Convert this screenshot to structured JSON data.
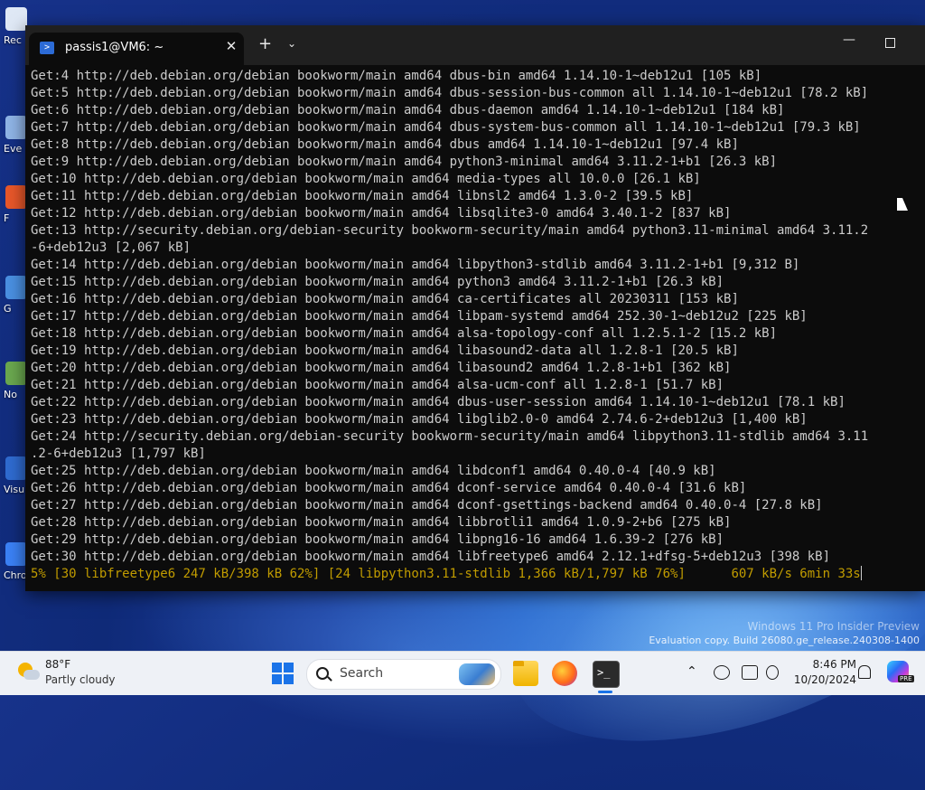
{
  "desktop": {
    "icons": [
      {
        "label": "Rec",
        "color": "#dfe8f5"
      },
      {
        "label": "Eve",
        "color": "#8fb4e6"
      },
      {
        "label": "F",
        "color": "#e8572a"
      },
      {
        "label": "G",
        "color": "#4a90e2"
      },
      {
        "label": "No",
        "color": "#6aa84f"
      },
      {
        "label": "Visu",
        "color": "#2f6bd0"
      },
      {
        "label": "Chromium",
        "color": "#3b82f6"
      }
    ],
    "watermark": {
      "line1": "Windows 11 Pro Insider Preview",
      "line2": "Evaluation copy. Build 26080.ge_release.240308-1400"
    }
  },
  "terminal": {
    "tab_title": "passis1@VM6: ~",
    "tab_icon": "powershell-icon",
    "lines": [
      "Get:4 http://deb.debian.org/debian bookworm/main amd64 dbus-bin amd64 1.14.10-1~deb12u1 [105 kB]",
      "Get:5 http://deb.debian.org/debian bookworm/main amd64 dbus-session-bus-common all 1.14.10-1~deb12u1 [78.2 kB]",
      "Get:6 http://deb.debian.org/debian bookworm/main amd64 dbus-daemon amd64 1.14.10-1~deb12u1 [184 kB]",
      "Get:7 http://deb.debian.org/debian bookworm/main amd64 dbus-system-bus-common all 1.14.10-1~deb12u1 [79.3 kB]",
      "Get:8 http://deb.debian.org/debian bookworm/main amd64 dbus amd64 1.14.10-1~deb12u1 [97.4 kB]",
      "Get:9 http://deb.debian.org/debian bookworm/main amd64 python3-minimal amd64 3.11.2-1+b1 [26.3 kB]",
      "Get:10 http://deb.debian.org/debian bookworm/main amd64 media-types all 10.0.0 [26.1 kB]",
      "Get:11 http://deb.debian.org/debian bookworm/main amd64 libnsl2 amd64 1.3.0-2 [39.5 kB]",
      "Get:12 http://deb.debian.org/debian bookworm/main amd64 libsqlite3-0 amd64 3.40.1-2 [837 kB]",
      "Get:13 http://security.debian.org/debian-security bookworm-security/main amd64 python3.11-minimal amd64 3.11.2",
      "-6+deb12u3 [2,067 kB]",
      "Get:14 http://deb.debian.org/debian bookworm/main amd64 libpython3-stdlib amd64 3.11.2-1+b1 [9,312 B]",
      "Get:15 http://deb.debian.org/debian bookworm/main amd64 python3 amd64 3.11.2-1+b1 [26.3 kB]",
      "Get:16 http://deb.debian.org/debian bookworm/main amd64 ca-certificates all 20230311 [153 kB]",
      "Get:17 http://deb.debian.org/debian bookworm/main amd64 libpam-systemd amd64 252.30-1~deb12u2 [225 kB]",
      "Get:18 http://deb.debian.org/debian bookworm/main amd64 alsa-topology-conf all 1.2.5.1-2 [15.2 kB]",
      "Get:19 http://deb.debian.org/debian bookworm/main amd64 libasound2-data all 1.2.8-1 [20.5 kB]",
      "Get:20 http://deb.debian.org/debian bookworm/main amd64 libasound2 amd64 1.2.8-1+b1 [362 kB]",
      "Get:21 http://deb.debian.org/debian bookworm/main amd64 alsa-ucm-conf all 1.2.8-1 [51.7 kB]",
      "Get:22 http://deb.debian.org/debian bookworm/main amd64 dbus-user-session amd64 1.14.10-1~deb12u1 [78.1 kB]",
      "Get:23 http://deb.debian.org/debian bookworm/main amd64 libglib2.0-0 amd64 2.74.6-2+deb12u3 [1,400 kB]",
      "Get:24 http://security.debian.org/debian-security bookworm-security/main amd64 libpython3.11-stdlib amd64 3.11",
      ".2-6+deb12u3 [1,797 kB]",
      "Get:25 http://deb.debian.org/debian bookworm/main amd64 libdconf1 amd64 0.40.0-4 [40.9 kB]",
      "Get:26 http://deb.debian.org/debian bookworm/main amd64 dconf-service amd64 0.40.0-4 [31.6 kB]",
      "Get:27 http://deb.debian.org/debian bookworm/main amd64 dconf-gsettings-backend amd64 0.40.0-4 [27.8 kB]",
      "Get:28 http://deb.debian.org/debian bookworm/main amd64 libbrotli1 amd64 1.0.9-2+b6 [275 kB]",
      "Get:29 http://deb.debian.org/debian bookworm/main amd64 libpng16-16 amd64 1.6.39-2 [276 kB]",
      "Get:30 http://deb.debian.org/debian bookworm/main amd64 libfreetype6 amd64 2.12.1+dfsg-5+deb12u3 [398 kB]"
    ],
    "progress_line": "5% [30 libfreetype6 247 kB/398 kB 62%] [24 libpython3.11-stdlib 1,366 kB/1,797 kB 76%]      607 kB/s 6min 33s",
    "colors": {
      "background": "#0c0c0c",
      "text": "#cccccc",
      "progress": "#c19c00"
    }
  },
  "taskbar": {
    "weather": {
      "temp": "88°F",
      "desc": "Partly cloudy"
    },
    "search_placeholder": "Search",
    "apps": [
      "file-explorer-icon",
      "firefox-icon",
      "terminal-icon"
    ],
    "clock": {
      "time": "8:46 PM",
      "date": "10/20/2024"
    },
    "copilot_badge": "PRE",
    "accent": "#1a73e8"
  }
}
